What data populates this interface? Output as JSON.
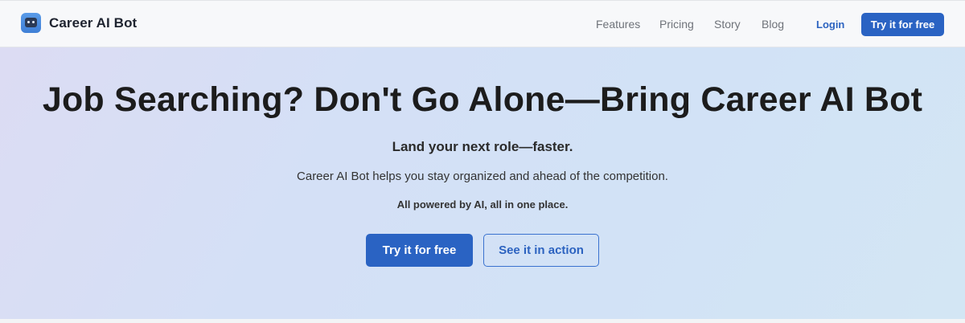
{
  "brand": {
    "name": "Career AI Bot",
    "logo_icon": "robot-face-icon"
  },
  "nav": {
    "items": [
      {
        "label": "Features"
      },
      {
        "label": "Pricing"
      },
      {
        "label": "Story"
      },
      {
        "label": "Blog"
      }
    ],
    "login_label": "Login",
    "cta_label": "Try it for free"
  },
  "hero": {
    "title": "Job Searching? Don't Go Alone—Bring Career AI Bot",
    "subtitle": "Land your next role—faster.",
    "description": "Career AI Bot helps you stay organized and ahead of the competition.",
    "tagline": "All powered by AI, all in one place.",
    "primary_cta": "Try it for free",
    "secondary_cta": "See it in action"
  },
  "colors": {
    "accent": "#2a63c3",
    "link": "#2c63c0",
    "nav_text": "#6f737a"
  }
}
